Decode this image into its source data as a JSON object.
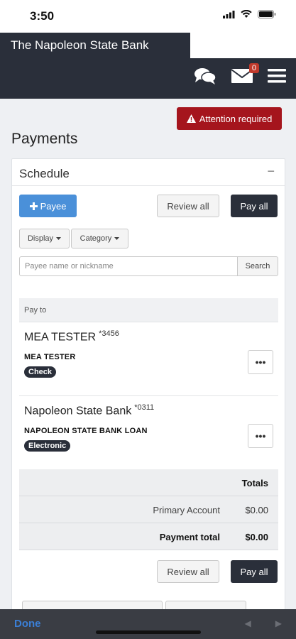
{
  "status_bar": {
    "time": "3:50"
  },
  "header": {
    "bank_name": "The Napoleon State Bank",
    "mail_badge": "0",
    "icons": [
      "chat-icon",
      "mail-icon",
      "menu-icon"
    ]
  },
  "alert": {
    "label": "Attention required",
    "icon": "warning-icon",
    "color": "#a5151d"
  },
  "page": {
    "title": "Payments"
  },
  "schedule": {
    "title": "Schedule",
    "collapse_symbol": "−",
    "add_payee_label": "Payee",
    "review_all_label": "Review all",
    "pay_all_label": "Pay all",
    "display_label": "Display",
    "category_label": "Category",
    "search_placeholder": "Payee name or nickname",
    "search_label": "Search",
    "pay_to_header": "Pay to",
    "payees": [
      {
        "name": "MEA TESTER",
        "account": "*3456",
        "nickname": "MEA TESTER",
        "method": "Check"
      },
      {
        "name": "Napoleon State Bank",
        "account": "*0311",
        "nickname": "NAPOLEON STATE BANK LOAN",
        "method": "Electronic"
      }
    ],
    "more_symbol": "•••",
    "totals": {
      "header": "Totals",
      "primary_account_label": "Primary Account",
      "primary_account_value": "$0.00",
      "payment_total_label": "Payment total",
      "payment_total_value": "$0.00"
    },
    "review_all_bottom": "Review all",
    "pay_all_bottom": "Pay all"
  },
  "bottom_bar": {
    "done_label": "Done",
    "prev_symbol": "◀",
    "next_symbol": "▶"
  },
  "colors": {
    "header_bg": "#2a2f3a",
    "accent_blue": "#4a90d9",
    "alert_red": "#a5151d"
  }
}
